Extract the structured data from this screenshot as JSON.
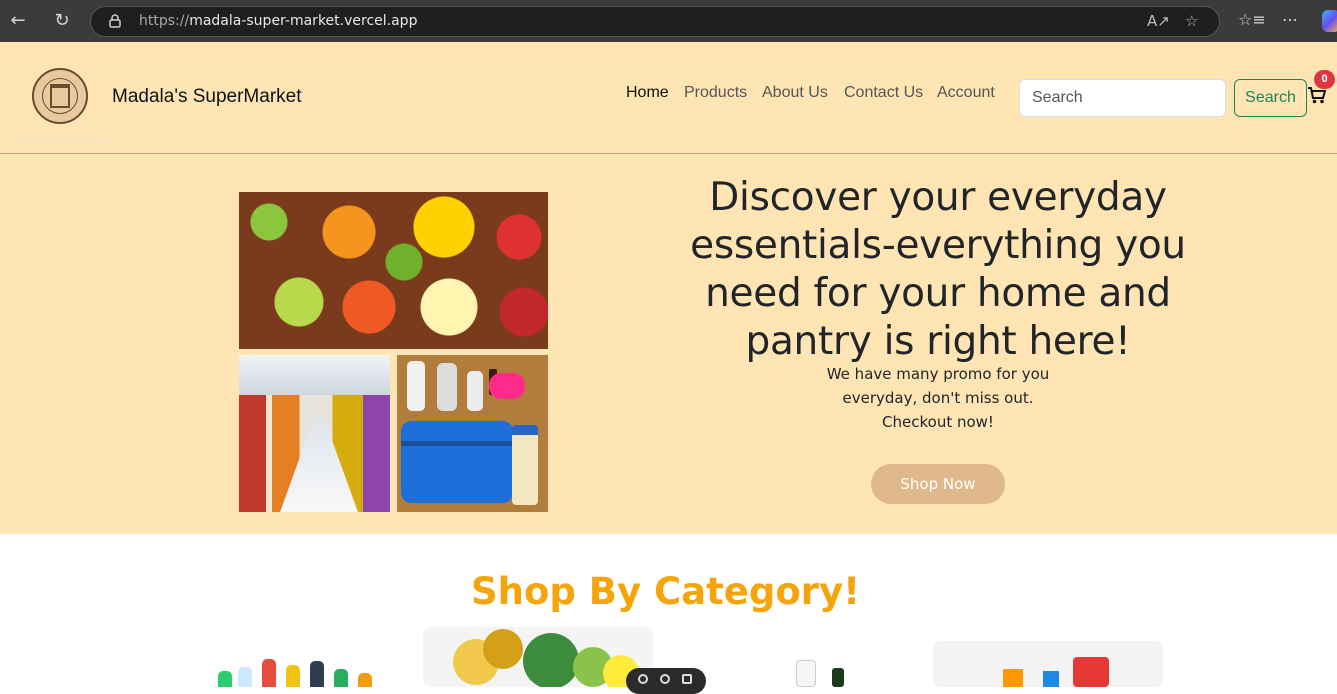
{
  "browser": {
    "url_scheme": "https://",
    "url_host": "madala-super-market.vercel.app"
  },
  "header": {
    "brand": "Madala's SuperMarket",
    "nav": [
      "Home",
      "Products",
      "About Us",
      "Contact Us",
      "Account"
    ],
    "search_placeholder": "Search",
    "search_button": "Search",
    "cart_count": "0"
  },
  "hero": {
    "title": "Discover your everyday essentials-everything you need for your home and pantry is right here!",
    "subtitle": "We have many promo for you everyday, don't miss out. Checkout now!",
    "cta": "Shop Now"
  },
  "categories": {
    "title": "Shop By Category!"
  },
  "colors": {
    "header_bg": "#ffe5b4",
    "accent_orange": "#f5a50a",
    "cta_bg": "#dfb88c",
    "search_green": "#198754",
    "badge_red": "#dc3545"
  }
}
